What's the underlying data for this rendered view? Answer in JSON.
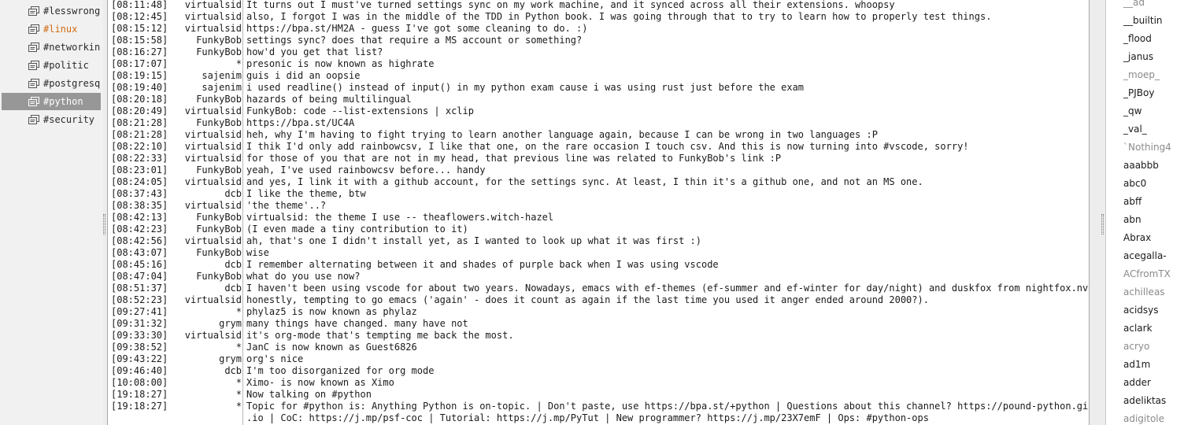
{
  "channels": [
    {
      "name": "#lesswrong",
      "state": "normal"
    },
    {
      "name": "#linux",
      "state": "highlight"
    },
    {
      "name": "#networking",
      "state": "normal"
    },
    {
      "name": "#politic",
      "state": "normal"
    },
    {
      "name": "#postgresql",
      "state": "normal"
    },
    {
      "name": "#python",
      "state": "selected"
    },
    {
      "name": "#security",
      "state": "normal"
    }
  ],
  "messages": [
    {
      "time": "[08:11:48]",
      "nick": "virtualsid",
      "text": "It turns out I must've turned settings sync on my work machine, and it synced across all their extensions. whoopsy"
    },
    {
      "time": "[08:12:45]",
      "nick": "virtualsid",
      "text": "also, I forgot I was in the middle of the TDD in Python book. I was going through that to try to learn how to properly test things."
    },
    {
      "time": "[08:15:12]",
      "nick": "virtualsid",
      "text": "https://bpa.st/HM2A - guess I've got some cleaning to do. :)"
    },
    {
      "time": "[08:15:58]",
      "nick": "FunkyBob",
      "text": "settings sync? does that require a MS account or something?"
    },
    {
      "time": "[08:16:27]",
      "nick": "FunkyBob",
      "text": "how'd you get that list?"
    },
    {
      "time": "[08:17:07]",
      "nick": "*",
      "text": "presonic is now known as highrate"
    },
    {
      "time": "[08:19:15]",
      "nick": "sajenim",
      "text": "guis i did an oopsie"
    },
    {
      "time": "[08:19:40]",
      "nick": "sajenim",
      "text": "i used readline() instead of input() in my python exam cause i was using rust just before the exam"
    },
    {
      "time": "[08:20:18]",
      "nick": "FunkyBob",
      "text": "hazards of being multilingual"
    },
    {
      "time": "[08:20:49]",
      "nick": "virtualsid",
      "text": "FunkyBob: code --list-extensions | xclip"
    },
    {
      "time": "[08:21:28]",
      "nick": "FunkyBob",
      "text": "https://bpa.st/UC4A"
    },
    {
      "time": "[08:21:28]",
      "nick": "virtualsid",
      "text": "heh, why I'm having to fight trying to learn another language again, because I can be wrong in two languages :P"
    },
    {
      "time": "[08:22:10]",
      "nick": "virtualsid",
      "text": "I thik I'd only add rainbowcsv, I like that one, on the rare occasion I touch csv. And this is now turning into #vscode, sorry!"
    },
    {
      "time": "[08:22:33]",
      "nick": "virtualsid",
      "text": "for those of you that are not in my head, that previous line was related to FunkyBob's link :P"
    },
    {
      "time": "[08:23:01]",
      "nick": "FunkyBob",
      "text": "yeah, I've used rainbowcsv before... handy"
    },
    {
      "time": "[08:24:05]",
      "nick": "virtualsid",
      "text": "and yes, I link it with a github account, for the settings sync. At least, I thin it's a github one, and not an MS one."
    },
    {
      "time": "[08:37:43]",
      "nick": "dcb",
      "text": "I like the theme, btw"
    },
    {
      "time": "[08:38:35]",
      "nick": "virtualsid",
      "text": "'the theme'..?"
    },
    {
      "time": "[08:42:13]",
      "nick": "FunkyBob",
      "text": "virtualsid: the theme I use -- theaflowers.witch-hazel"
    },
    {
      "time": "[08:42:23]",
      "nick": "FunkyBob",
      "text": "(I even made a tiny contribution to it)"
    },
    {
      "time": "[08:42:56]",
      "nick": "virtualsid",
      "text": "ah, that's one I didn't install yet, as I wanted to look up what it was first :)"
    },
    {
      "time": "[08:43:07]",
      "nick": "FunkyBob",
      "text": "wise"
    },
    {
      "time": "[08:45:16]",
      "nick": "dcb",
      "text": "I remember alternating between it and shades of purple back when I was using vscode"
    },
    {
      "time": "[08:47:04]",
      "nick": "FunkyBob",
      "text": "what do you use now?"
    },
    {
      "time": "[08:51:37]",
      "nick": "dcb",
      "text": "I haven't been using vscode for about two years. Nowadays, emacs with ef-themes (ef-summer and ef-winter for day/night) and duskfox from nightfox.nvim"
    },
    {
      "time": "[08:52:23]",
      "nick": "virtualsid",
      "text": "honestly, tempting to go emacs ('again' - does it count as again if the last time you used it anger ended around 2000?)."
    },
    {
      "time": "[09:27:41]",
      "nick": "*",
      "text": "phylaz5 is now known as phylaz"
    },
    {
      "time": "[09:31:32]",
      "nick": "grym",
      "text": "many things have changed. many have not"
    },
    {
      "time": "[09:33:30]",
      "nick": "virtualsid",
      "text": "it's org-mode that's tempting me back the most."
    },
    {
      "time": "[09:38:52]",
      "nick": "*",
      "text": "JanC is now known as Guest6826"
    },
    {
      "time": "[09:43:22]",
      "nick": "grym",
      "text": "org's nice"
    },
    {
      "time": "[09:46:40]",
      "nick": "dcb",
      "text": "I'm too disorganized for org mode"
    },
    {
      "time": "[10:08:00]",
      "nick": "*",
      "text": "Ximo- is now known as Ximo"
    },
    {
      "time": "[19:18:27]",
      "nick": "*",
      "text": "Now talking on #python"
    },
    {
      "time": "[19:18:27]",
      "nick": "*",
      "text": "Topic for #python is: Anything Python is on-topic. | Don't paste, use https://bpa.st/+python | Questions about this channel? https://pound-python.github"
    },
    {
      "time": "",
      "nick": "",
      "text": ".io | CoC: https://j.mp/psf-coc | Tutorial: https://j.mp/PyTut | New programmer? https://j.mp/23X7emF | Ops: #python-ops"
    }
  ],
  "nicks": [
    {
      "name": "__ad",
      "away": true
    },
    {
      "name": "__builtin",
      "away": false
    },
    {
      "name": "_flood",
      "away": false
    },
    {
      "name": "_janus",
      "away": false
    },
    {
      "name": "_moep_",
      "away": true
    },
    {
      "name": "_PJBoy",
      "away": false
    },
    {
      "name": "_qw",
      "away": false
    },
    {
      "name": "_val_",
      "away": false
    },
    {
      "name": "`Nothing4",
      "away": true
    },
    {
      "name": "aaabbb",
      "away": false
    },
    {
      "name": "abc0",
      "away": false
    },
    {
      "name": "abff",
      "away": false
    },
    {
      "name": "abn",
      "away": false
    },
    {
      "name": "Abrax",
      "away": false
    },
    {
      "name": "acegalla-",
      "away": false
    },
    {
      "name": "ACfromTX",
      "away": true
    },
    {
      "name": "achilleas",
      "away": true
    },
    {
      "name": "acidsys",
      "away": false
    },
    {
      "name": "aclark",
      "away": false
    },
    {
      "name": "acryo",
      "away": true
    },
    {
      "name": "ad1m",
      "away": false
    },
    {
      "name": "adder",
      "away": false
    },
    {
      "name": "adeliktas",
      "away": false
    },
    {
      "name": "adigitole",
      "away": true
    }
  ],
  "colors": {
    "highlight": "#d26a10",
    "selected_bg": "#979797",
    "away_nick": "#8a8a8a"
  }
}
